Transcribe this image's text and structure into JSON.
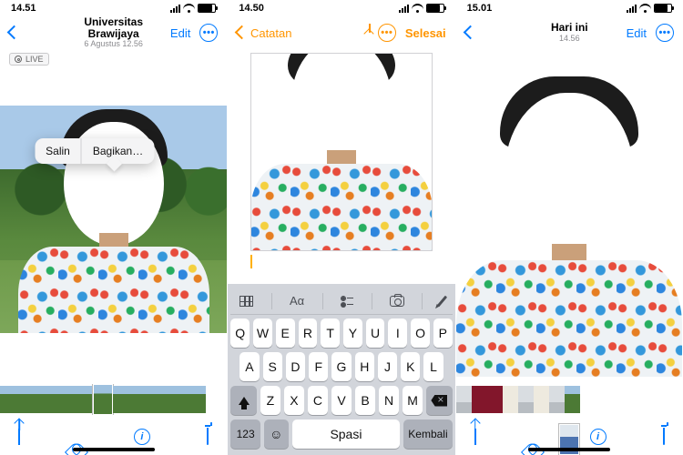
{
  "screens": [
    {
      "status_time": "14.51",
      "nav_title": "Universitas Brawijaya",
      "nav_subtitle": "6 Agustus 12.56",
      "edit_label": "Edit",
      "live_label": "LIVE",
      "context_menu": {
        "copy": "Salin",
        "share": "Bagikan…"
      }
    },
    {
      "status_time": "14.50",
      "back_label": "Catatan",
      "done_label": "Selesai",
      "keyboard": {
        "toolbar_aa": "Aα",
        "row1": [
          "Q",
          "W",
          "E",
          "R",
          "T",
          "Y",
          "U",
          "I",
          "O",
          "P"
        ],
        "row2": [
          "A",
          "S",
          "D",
          "F",
          "G",
          "H",
          "J",
          "K",
          "L"
        ],
        "row3": [
          "Z",
          "X",
          "C",
          "V",
          "B",
          "N",
          "M"
        ],
        "numkey": "123",
        "space": "Spasi",
        "return": "Kembali"
      }
    },
    {
      "status_time": "15.01",
      "nav_title": "Hari ini",
      "nav_subtitle": "14.56",
      "edit_label": "Edit"
    }
  ],
  "info_glyph": "i"
}
